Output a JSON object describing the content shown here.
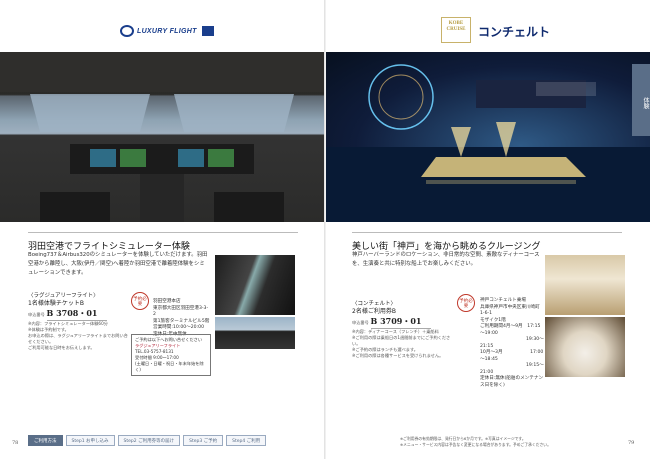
{
  "left": {
    "logo_text": "LUXURY FLIGHT",
    "heading": "羽田空港でフライトシミュレーター体験",
    "body": "Boeing737＆Airbus320のシミュレーターを体験していただけます。羽田空港から離陸し、大阪(伊丹／関空)へ着陸か羽田空港で離着陸体験をシミュレーションできます。",
    "ticket": {
      "company": "〈ラグジュアリーフライト〉",
      "title": "1名様体験チケットB",
      "code_label": "申込番号",
      "code": "B 3708・01",
      "notes": "※内容：フライトシミュレーター体験60分\n※体験は予約制です。\nお申込の際は、ラグジュアリーフライトまでお問い合せください。\nご利用可能な日時をお伝えします。"
    },
    "badge": "予約必要",
    "address": "羽田空港本店\n東京都大田区羽田空港3-3-2\n第1旅客ターミナルビル5階\n営業時間:10:00～20:00\n定休日:年中無休",
    "notice": {
      "line1": "ご予約は以下へお問い合せください",
      "line2": "ラグジュアリーフライト",
      "line3": "TEL.03-5757-8131",
      "line4": "受付時間 9:00～17:00",
      "line5": "(土曜日・日曜・祝日・年末年始を除く)"
    },
    "page_number": "78"
  },
  "right": {
    "logo_emblem": "KOBE CRUISE",
    "logo_text": "コンチェルト",
    "side_tab": "体験",
    "heading": "美しい街「神戸」を海から眺めるクルージング",
    "body": "神戸ハーバーランドのロケーション、非日常的な空間、素敵なディナーコースを、生演奏と共に特別な船上でお楽しみください。",
    "ticket": {
      "company": "〈コンチェルト〉",
      "title": "2名様ご利用券B",
      "code_label": "申込番号",
      "code": "B 3709・01",
      "notes": "※内容：ディナーコース（フレンチ）＋乗船料\n※ご利用の際は乗船日の1週間前までにご予約ください。\n※ご予約の際はランチも選べます。\n※ご利用の際は各種サービスを受けられません。"
    },
    "badge": "予約必要",
    "address": "神戸コンチェルト乗場\n兵庫県神戸市中央区東川崎町1-6-1\nモザイク1階\nご利用期間4月～9月　17:15～19:00\n　　　　　　　　　　19:30～21:15\n10月～3月　　　　　　17:00～18:45\n　　　　　　　　　　19:15～21:00\n定休日:無休(船舶のメンテナンス日を除く)",
    "page_number": "79",
    "footnote": "※ご利用券の有効期限は、発行日から6か月です。※写真はイメージです。\n※メニュー・サービス内容は予告なく変更になる場合があります。予めご了承ください。"
  },
  "steps": [
    {
      "label": "ご利用方法"
    },
    {
      "label": "Step1 お申し込み"
    },
    {
      "label": "Step2 ご利用券等の届け"
    },
    {
      "label": "Step3 ご予約"
    },
    {
      "label": "Step4 ご利用"
    }
  ]
}
